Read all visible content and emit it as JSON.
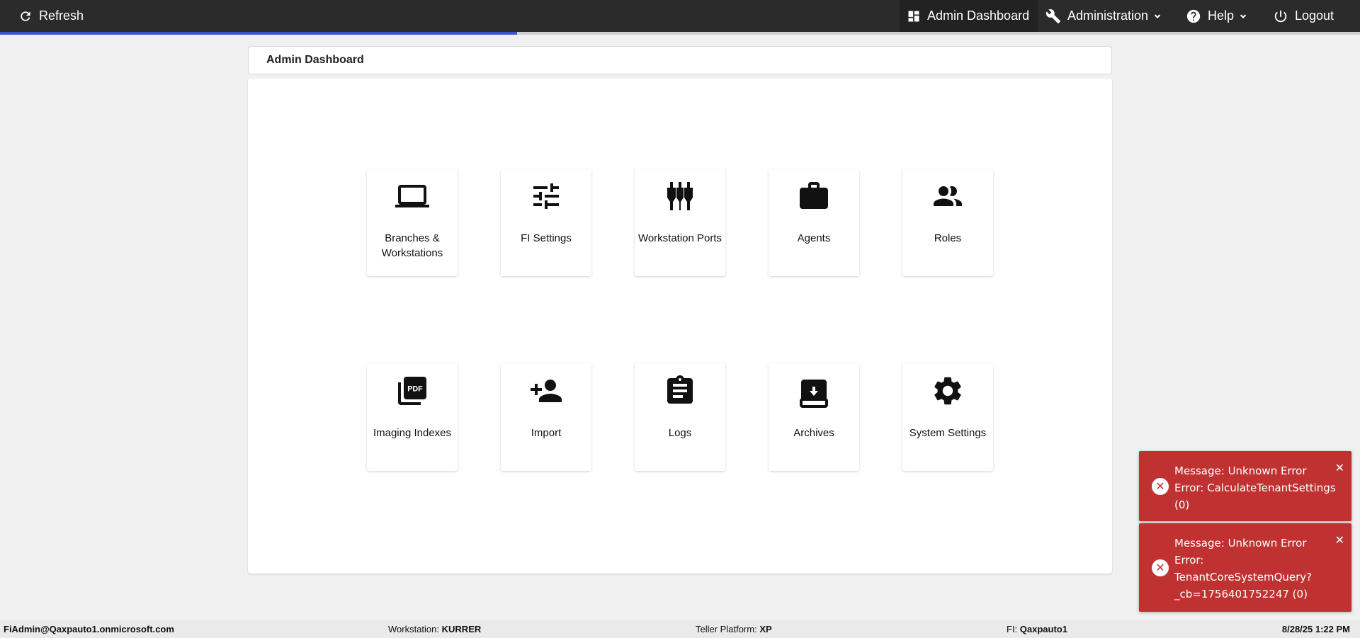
{
  "topbar": {
    "refresh_label": "Refresh",
    "admin_dashboard_label": "Admin Dashboard",
    "administration_label": "Administration",
    "help_label": "Help",
    "logout_label": "Logout",
    "load_progress": 0.38
  },
  "breadcrumb": {
    "title": "Admin Dashboard"
  },
  "tiles": [
    {
      "label": "Branches & Workstations",
      "icon": "laptop-icon"
    },
    {
      "label": "FI Settings",
      "icon": "sliders-icon"
    },
    {
      "label": "Workstation Ports",
      "icon": "ports-icon"
    },
    {
      "label": "Agents",
      "icon": "briefcase-icon"
    },
    {
      "label": "Roles",
      "icon": "people-icon"
    },
    {
      "label": "Imaging Indexes",
      "icon": "pdf-icon"
    },
    {
      "label": "Import",
      "icon": "add-person-icon"
    },
    {
      "label": "Logs",
      "icon": "clipboard-icon"
    },
    {
      "label": "Archives",
      "icon": "archive-icon"
    },
    {
      "label": "System Settings",
      "icon": "gear-icon"
    }
  ],
  "toasts": [
    {
      "line1": "Message: Unknown Error",
      "line2": "Error: CalculateTenantSettings",
      "line3": "(0)"
    },
    {
      "line1": "Message: Unknown Error",
      "line2": "Error:",
      "line3": "TenantCoreSystemQuery?",
      "line4": "_cb=1756401752247 (0)"
    }
  ],
  "status": {
    "user": "FiAdmin@Qaxpauto1.onmicrosoft.com",
    "workstation_label": "Workstation:",
    "workstation_value": "KURRER",
    "teller_label": "Teller Platform:",
    "teller_value": "XP",
    "fi_label": "FI:",
    "fi_value": "Qaxpauto1",
    "datetime": "8/28/25 1:22 PM"
  },
  "colors": {
    "topbar": "#2b2b2b",
    "progress": "#3b55c8",
    "toast": "#c03232"
  }
}
